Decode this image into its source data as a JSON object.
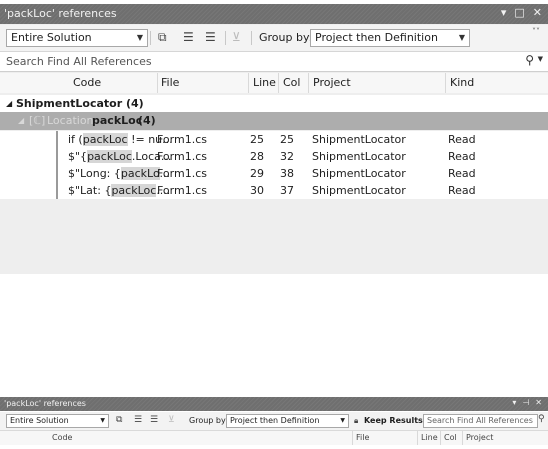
{
  "window": {
    "title": "'packLoc' references",
    "controls": {
      "dropdown": "▾",
      "maximize": "□",
      "close": "✕"
    }
  },
  "toolbar": {
    "scope_value": "Entire Solution",
    "group_by_label": "Group by:",
    "group_by_value": "Project then Definition",
    "overflow_glyph": "˅˅"
  },
  "search": {
    "placeholder": "Search Find All References"
  },
  "columns": {
    "code": "Code",
    "file": "File",
    "line": "Line",
    "col": "Col",
    "project": "Project",
    "kind": "Kind"
  },
  "group": {
    "glyph": "◢",
    "label": "ShipmentLocator (4)"
  },
  "definition": {
    "glyph": "◢",
    "icon": "[ℂ]",
    "prefix": "Location",
    "name": "packLoc",
    "count": "(4)"
  },
  "rows": [
    {
      "code_pre": "if (",
      "code_hl": "packLoc",
      "code_post": " != nu...",
      "file": "Form1.cs",
      "line": "25",
      "col": "25",
      "project": "ShipmentLocator",
      "kind": "Read"
    },
    {
      "code_pre": "$\"{",
      "code_hl": "packLoc",
      "code_post": ".Loca...",
      "file": "Form1.cs",
      "line": "28",
      "col": "32",
      "project": "ShipmentLocator",
      "kind": "Read"
    },
    {
      "code_pre": "$\"Long: {",
      "code_hl": "packLo",
      "code_post": "...",
      "file": "Form1.cs",
      "line": "29",
      "col": "38",
      "project": "ShipmentLocator",
      "kind": "Read"
    },
    {
      "code_pre": "$\"Lat: {",
      "code_hl": "packLoc",
      "code_post": "....",
      "file": "Form1.cs",
      "line": "30",
      "col": "37",
      "project": "ShipmentLocator",
      "kind": "Read"
    }
  ],
  "mini": {
    "title": "'packLoc' references",
    "controls": {
      "dropdown": "▾",
      "pin": "⊣",
      "close": "✕"
    },
    "scope_value": "Entire Solution",
    "group_by_label": "Group by:",
    "group_by_value": "Project then Definition",
    "keep_results": "Keep Results",
    "search_placeholder": "Search Find All References",
    "columns": {
      "code": "Code",
      "file": "File",
      "line": "Line",
      "col": "Col",
      "project": "Project"
    }
  },
  "icons": {
    "copy": "copy-icon",
    "collapse": "collapse-all-icon",
    "expand": "expand-all-icon",
    "filter": "filter-icon",
    "search": "search-icon",
    "lock": "lock-icon"
  },
  "colors": {
    "titlebar": "#6f6f6f",
    "selected_row": "#adadad",
    "highlight": "#d6d6d6"
  }
}
